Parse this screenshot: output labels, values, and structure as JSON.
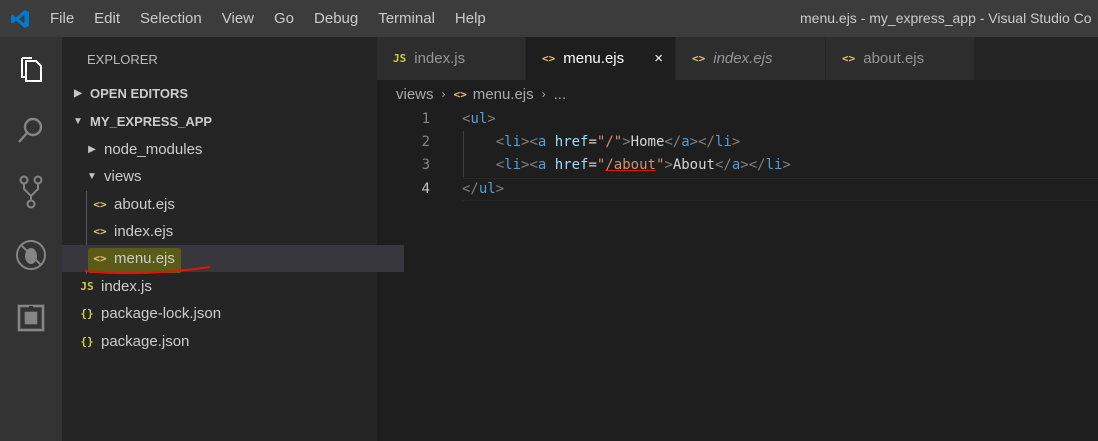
{
  "titlebar": {
    "menu": [
      "File",
      "Edit",
      "Selection",
      "View",
      "Go",
      "Debug",
      "Terminal",
      "Help"
    ],
    "window_title": "menu.ejs - my_express_app - Visual Studio Co"
  },
  "activitybar": {
    "icons": [
      "explorer-icon",
      "search-icon",
      "source-control-icon",
      "debug-icon",
      "extensions-icon"
    ]
  },
  "sidebar": {
    "title": "EXPLORER",
    "open_editors": "OPEN EDITORS",
    "project": "MY_EXPRESS_APP",
    "items": [
      {
        "label": "node_modules",
        "type": "folder",
        "state": "collapsed"
      },
      {
        "label": "views",
        "type": "folder",
        "state": "expanded"
      },
      {
        "label": "about.ejs",
        "type": "ejs",
        "icon_text": "<>"
      },
      {
        "label": "index.ejs",
        "type": "ejs",
        "icon_text": "<>"
      },
      {
        "label": "menu.ejs",
        "type": "ejs",
        "icon_text": "<>",
        "selected": true
      },
      {
        "label": "index.js",
        "type": "js",
        "icon_text": "JS"
      },
      {
        "label": "package-lock.json",
        "type": "json",
        "icon_text": "{}"
      },
      {
        "label": "package.json",
        "type": "json",
        "icon_text": "{}"
      }
    ]
  },
  "tabs": [
    {
      "label": "index.js",
      "icon_text": "JS",
      "active": false,
      "italic": false
    },
    {
      "label": "menu.ejs",
      "icon_text": "<>",
      "active": true,
      "italic": false,
      "close": "×"
    },
    {
      "label": "index.ejs",
      "icon_text": "<>",
      "active": false,
      "italic": true
    },
    {
      "label": "about.ejs",
      "icon_text": "<>",
      "active": false,
      "italic": false
    }
  ],
  "breadcrumb": {
    "folder": "views",
    "file_icon": "<>",
    "file": "menu.ejs",
    "more": "..."
  },
  "editor": {
    "line_numbers": [
      "1",
      "2",
      "3",
      "4"
    ],
    "lines": [
      "<ul>",
      "    <li><a href=\"/\">Home</a></li>",
      "    <li><a href=\"/about\">About</a></li>",
      "</ul>"
    ],
    "current_line": 4
  },
  "colors": {
    "accent_selected_ejs": "#e5c07b",
    "annotation_underline": "#e51400",
    "highlight": "#5b5b18"
  }
}
